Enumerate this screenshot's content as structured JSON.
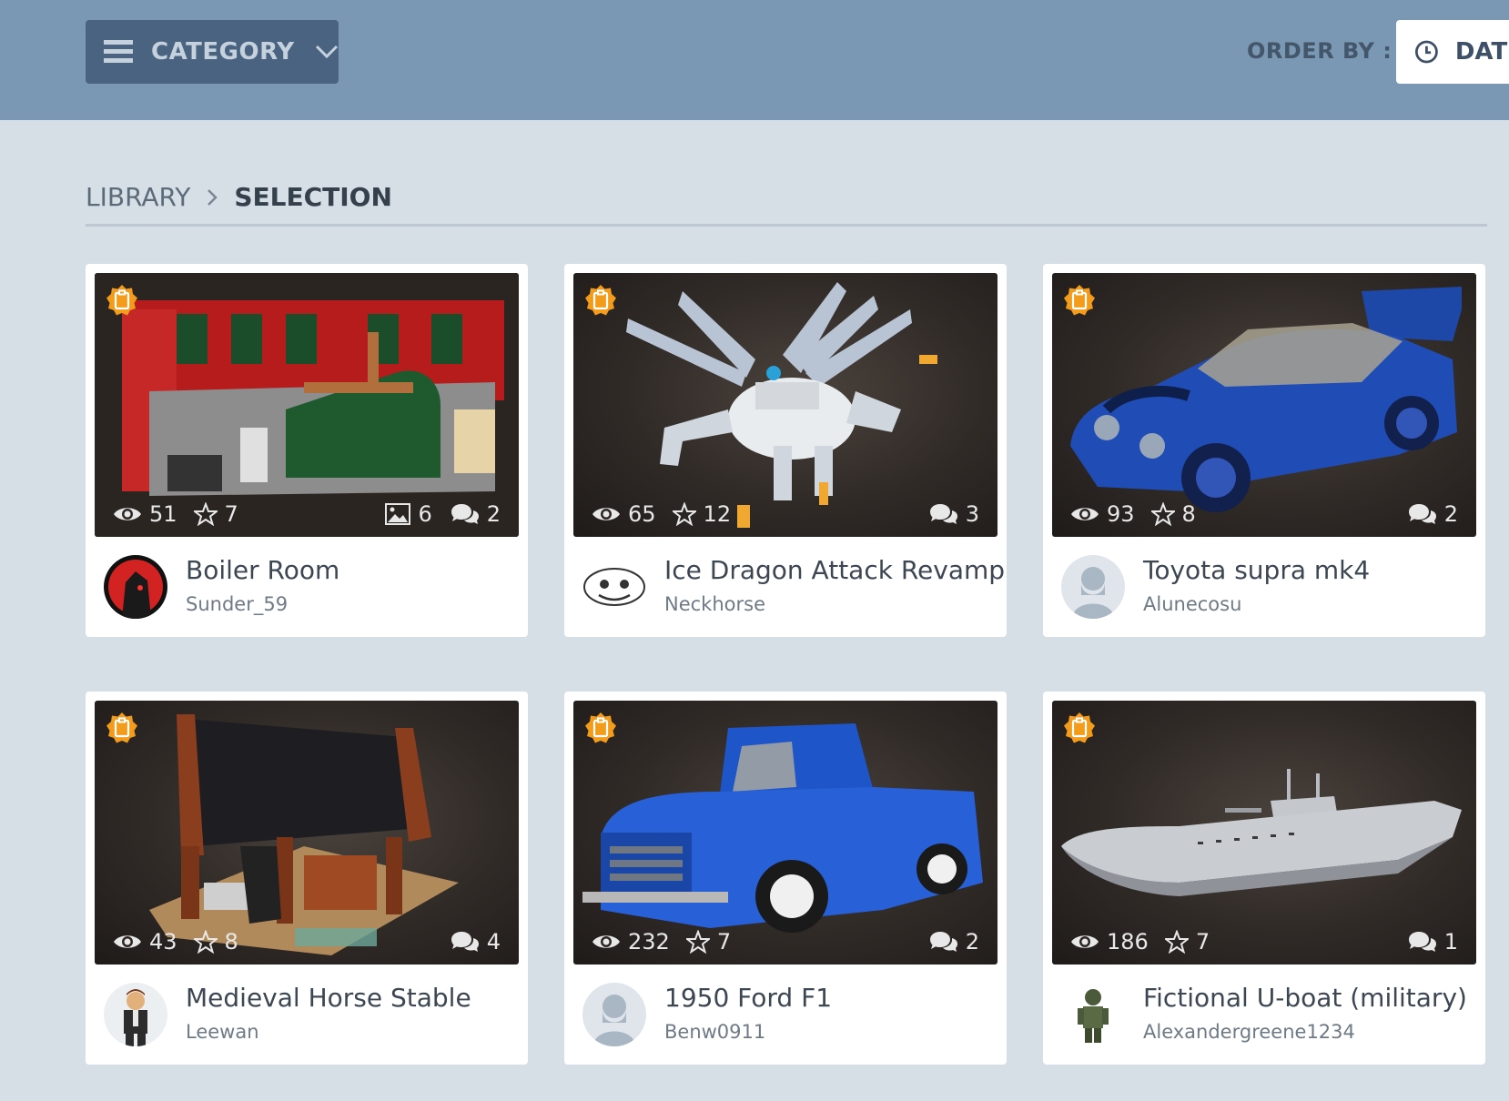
{
  "header": {
    "category_label": "CATEGORY",
    "order_by_label": "ORDER BY :",
    "order_value": "DATE"
  },
  "breadcrumb": {
    "library": "LIBRARY",
    "current": "SELECTION"
  },
  "colors": {
    "topbar": "#7a98b3",
    "category_button": "#4a6380",
    "page_background": "#d6dee6",
    "badge": "#f39c1c"
  },
  "cards": [
    {
      "title": "Boiler Room",
      "author": "Sunder_59",
      "views": "51",
      "stars": "7",
      "images": "6",
      "comments": "2",
      "badge_icon": "featured-badge-icon"
    },
    {
      "title": "Ice Dragon Attack Revamp",
      "author": "Neckhorse",
      "views": "65",
      "stars": "12",
      "comments": "3",
      "badge_icon": "featured-badge-icon"
    },
    {
      "title": "Toyota supra mk4",
      "author": "Alunecosu",
      "views": "93",
      "stars": "8",
      "comments": "2",
      "badge_icon": "featured-badge-icon"
    },
    {
      "title": "Medieval Horse Stable",
      "author": "Leewan",
      "views": "43",
      "stars": "8",
      "comments": "4",
      "badge_icon": "featured-badge-icon"
    },
    {
      "title": "1950 Ford F1",
      "author": "Benw0911",
      "views": "232",
      "stars": "7",
      "comments": "2",
      "badge_icon": "featured-badge-icon"
    },
    {
      "title": "Fictional U-boat (military)",
      "author": "Alexandergreene1234",
      "views": "186",
      "stars": "7",
      "comments": "1",
      "badge_icon": "featured-badge-icon"
    }
  ]
}
